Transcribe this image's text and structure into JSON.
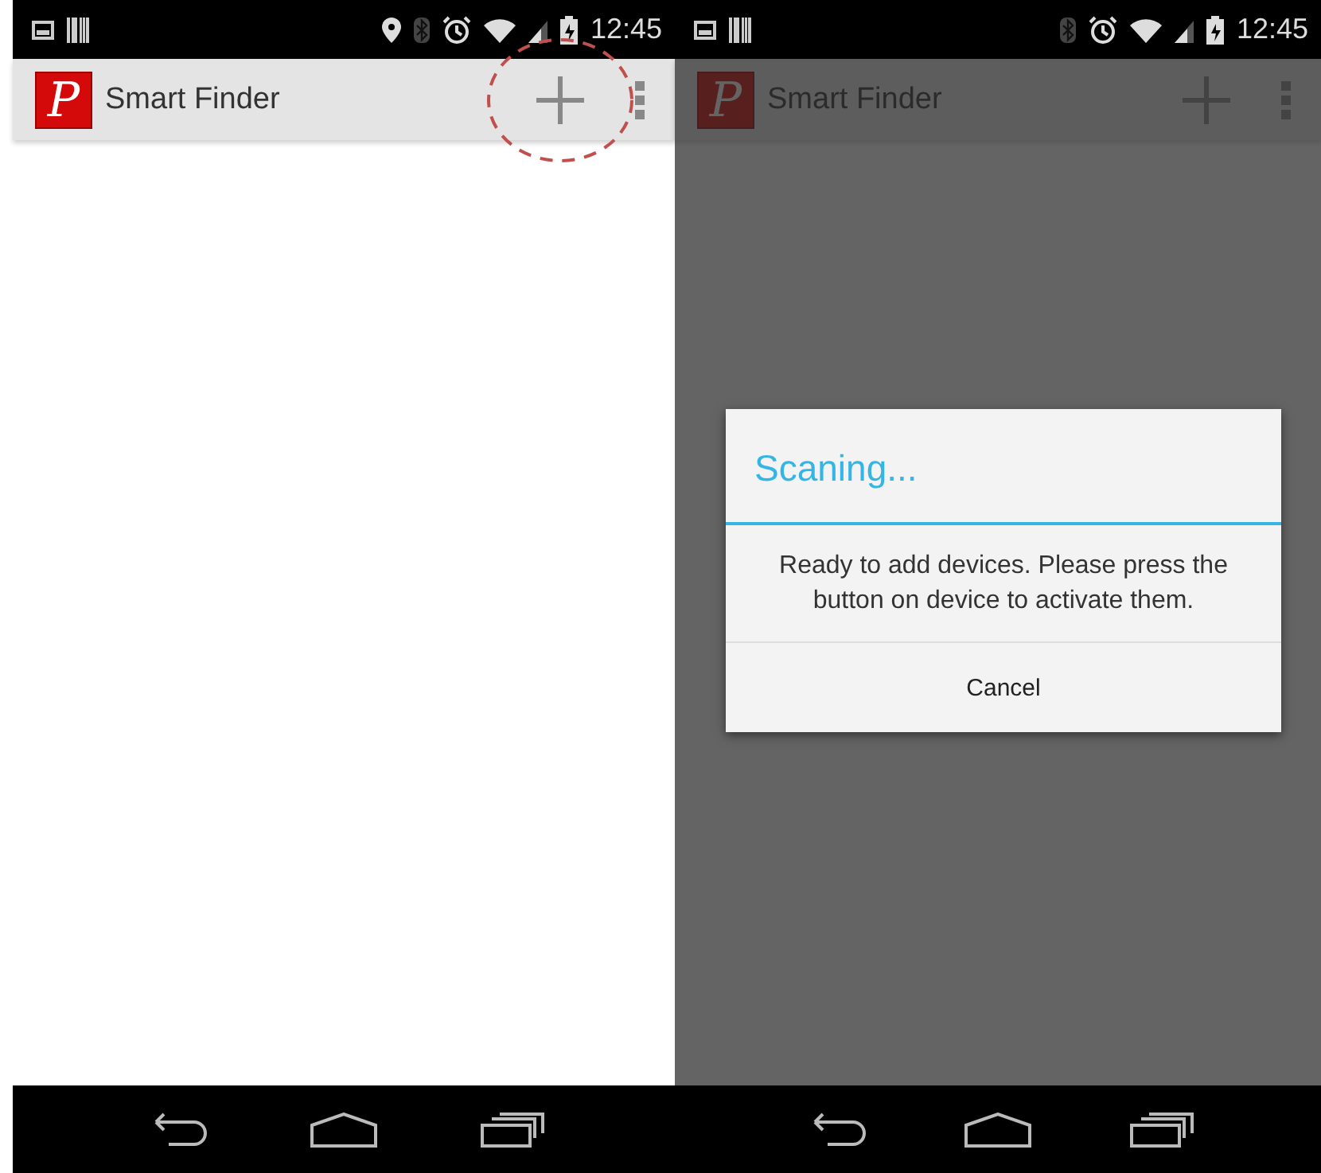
{
  "screens": [
    {
      "status_bar": {
        "notification_icons": [
          {
            "kind": "picture"
          },
          {
            "kind": "barcode"
          }
        ],
        "status_icons": [
          {
            "kind": "location"
          },
          {
            "kind": "bluetooth"
          },
          {
            "kind": "alarm"
          },
          {
            "kind": "wifi"
          },
          {
            "kind": "signal"
          },
          {
            "kind": "battery"
          }
        ],
        "time": "12:45"
      },
      "app_bar": {
        "logo_letter": "P",
        "title": "Smart Finder"
      },
      "add_button_highlighted": true,
      "dimmed": false
    },
    {
      "status_bar": {
        "notification_icons": [
          {
            "kind": "picture"
          },
          {
            "kind": "barcode"
          }
        ],
        "status_icons": [
          {
            "kind": "bluetooth"
          },
          {
            "kind": "alarm"
          },
          {
            "kind": "wifi"
          },
          {
            "kind": "signal"
          },
          {
            "kind": "battery"
          }
        ],
        "time": "12:45"
      },
      "app_bar": {
        "logo_letter": "P",
        "title": "Smart Finder"
      },
      "add_button_highlighted": false,
      "dimmed": true,
      "dialog": {
        "title": "Scaning...",
        "message": "Ready to add devices. Please press the button on device to activate them.",
        "button": "Cancel"
      }
    }
  ]
}
